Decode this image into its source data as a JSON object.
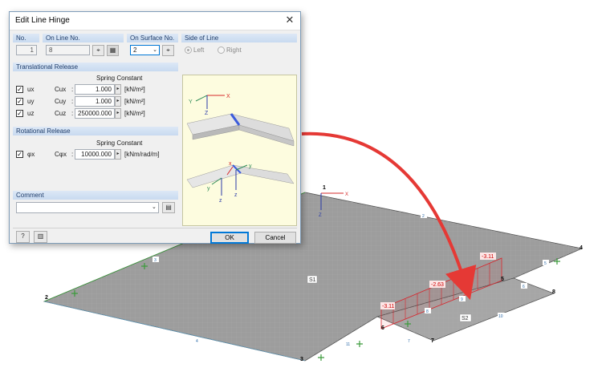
{
  "dialog": {
    "title": "Edit Line Hinge",
    "headers": {
      "no": "No.",
      "on_line_no": "On Line No.",
      "on_surface_no": "On Surface No.",
      "side_of_line": "Side of Line"
    },
    "no_value": "1",
    "on_line_value": "8",
    "on_surface_value": "2",
    "side_left": "Left",
    "side_right": "Right",
    "translational": {
      "title": "Translational Release",
      "spring_header": "Spring Constant",
      "rows": [
        {
          "label": "ux",
          "coef": "Cux",
          "value": "1.000",
          "unit": "[kN/m²]"
        },
        {
          "label": "uy",
          "coef": "Cuy",
          "value": "1.000",
          "unit": "[kN/m²]"
        },
        {
          "label": "uz",
          "coef": "Cuz",
          "value": "250000.000",
          "unit": "[kN/m²]"
        }
      ]
    },
    "rotational": {
      "title": "Rotational Release",
      "spring_header": "Spring Constant",
      "rows": [
        {
          "label": "φx",
          "coef": "Cφx",
          "value": "10000.000",
          "unit": "[kNm/rad/m]"
        }
      ]
    },
    "comment": {
      "title": "Comment",
      "value": ""
    },
    "buttons": {
      "ok": "OK",
      "cancel": "Cancel"
    },
    "preview_axes": {
      "x": "X",
      "y": "Y",
      "z": "Z",
      "lx": "x",
      "ly": "y",
      "lz": "z"
    },
    "colors": {
      "section_header": "#c8daf0",
      "accent": "#0078d7",
      "preview_bg": "#fdfcdf"
    }
  },
  "model": {
    "axes": {
      "x": "X",
      "z": "Z"
    },
    "node_labels": [
      "1",
      "2",
      "3",
      "4",
      "5",
      "6",
      "7",
      "8"
    ],
    "surface_labels": [
      "S1",
      "S2"
    ],
    "line_labels": [
      "1",
      "2",
      "3",
      "4",
      "5",
      "6",
      "7",
      "8",
      "9",
      "10",
      "11"
    ],
    "result_values": [
      "-3.11",
      "-2.63",
      "-3.11"
    ],
    "colors": {
      "surface": "#9a9a9a",
      "hinge_result": "#d8232a",
      "edge_green": "#3c9b3c",
      "arrow": "#e53935"
    }
  }
}
